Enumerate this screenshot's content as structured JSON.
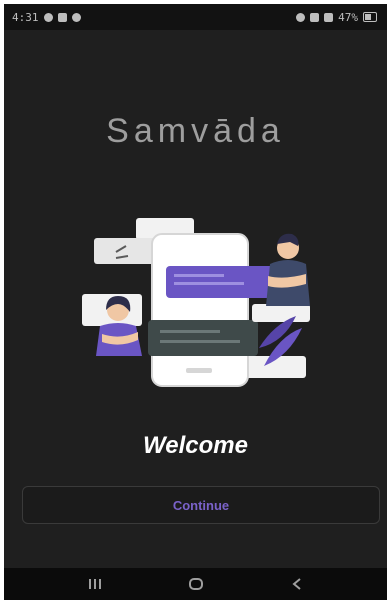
{
  "status_bar": {
    "time": "4:31",
    "right_text": "47%"
  },
  "app": {
    "title": "Samvāda"
  },
  "welcome": {
    "text": "Welcome"
  },
  "actions": {
    "continue_label": "Continue"
  },
  "nav": {
    "recents": "recents-icon",
    "home": "home-icon",
    "back": "back-icon"
  },
  "colors": {
    "background": "#1f1f1f",
    "accent": "#7a62c9",
    "purple": "#6a55c4",
    "dark_bubble": "#3f4a4a"
  }
}
